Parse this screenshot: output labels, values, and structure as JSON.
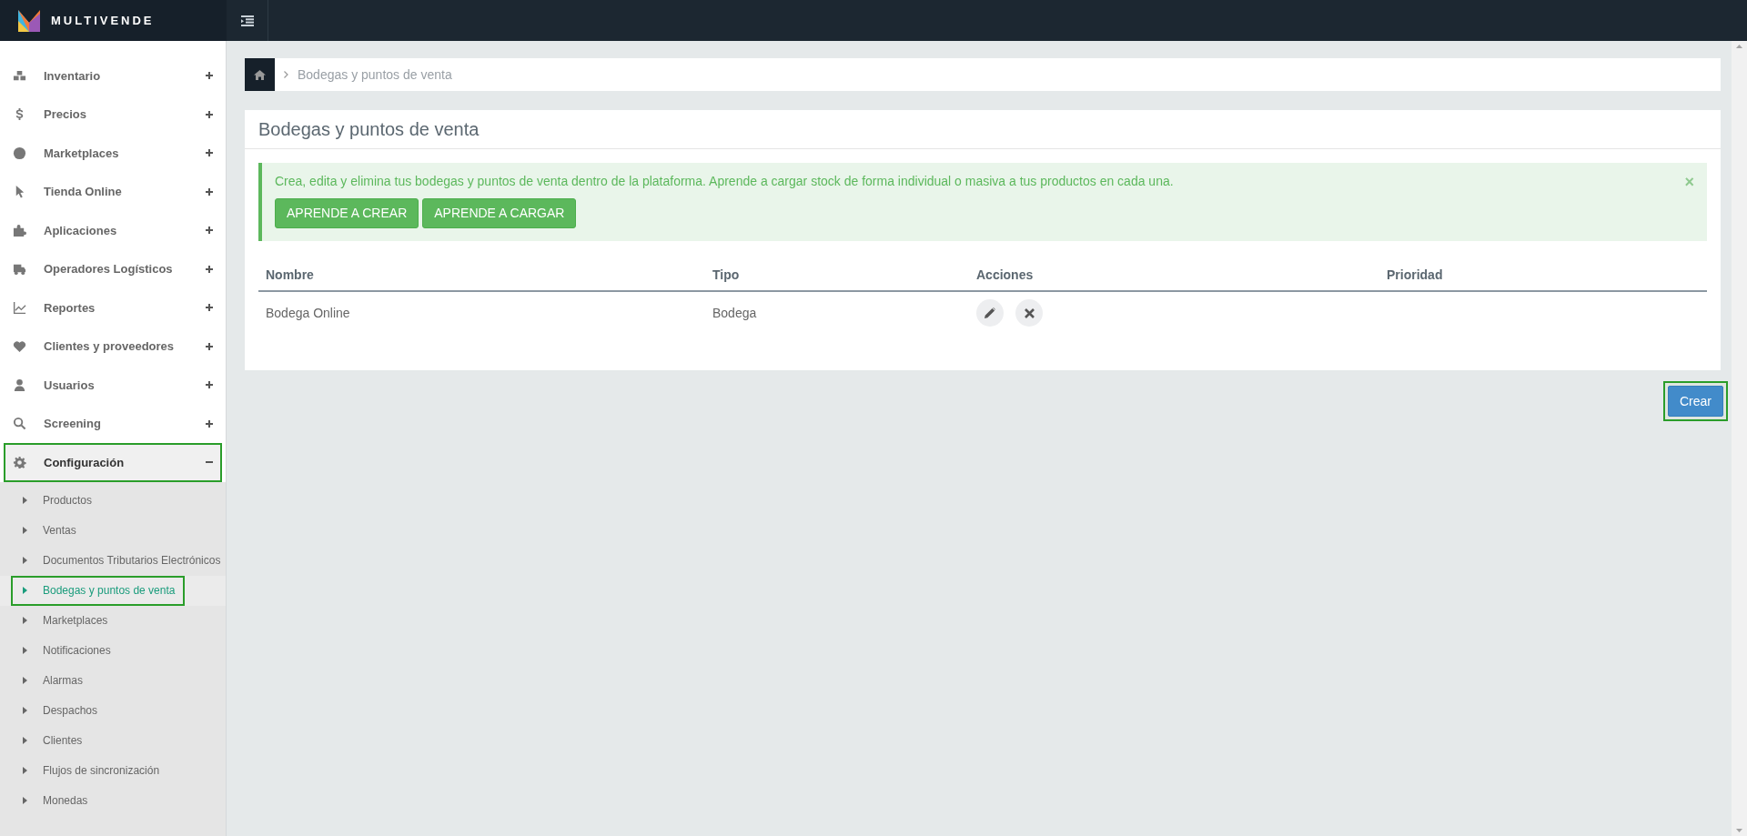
{
  "brand": {
    "name": "MULTIVENDE"
  },
  "sidebar": {
    "items": [
      {
        "label": "Inventario",
        "expanded": false,
        "highlighted": false
      },
      {
        "label": "Precios",
        "expanded": false,
        "highlighted": false
      },
      {
        "label": "Marketplaces",
        "expanded": false,
        "highlighted": false
      },
      {
        "label": "Tienda Online",
        "expanded": false,
        "highlighted": false
      },
      {
        "label": "Aplicaciones",
        "expanded": false,
        "highlighted": false
      },
      {
        "label": "Operadores Logísticos",
        "expanded": false,
        "highlighted": false
      },
      {
        "label": "Reportes",
        "expanded": false,
        "highlighted": false
      },
      {
        "label": "Clientes y proveedores",
        "expanded": false,
        "highlighted": false
      },
      {
        "label": "Usuarios",
        "expanded": false,
        "highlighted": false
      },
      {
        "label": "Screening",
        "expanded": false,
        "highlighted": false
      },
      {
        "label": "Configuración",
        "expanded": true,
        "highlighted": true,
        "children": [
          {
            "label": "Productos",
            "selected": false
          },
          {
            "label": "Ventas",
            "selected": false
          },
          {
            "label": "Documentos Tributarios Electrónicos",
            "selected": false
          },
          {
            "label": "Bodegas y puntos de venta",
            "selected": true
          },
          {
            "label": "Marketplaces",
            "selected": false
          },
          {
            "label": "Notificaciones",
            "selected": false
          },
          {
            "label": "Alarmas",
            "selected": false
          },
          {
            "label": "Despachos",
            "selected": false
          },
          {
            "label": "Clientes",
            "selected": false
          },
          {
            "label": "Flujos de sincronización",
            "selected": false
          },
          {
            "label": "Monedas",
            "selected": false
          }
        ]
      }
    ]
  },
  "breadcrumb": [
    "Bodegas y puntos de venta"
  ],
  "card": {
    "title": "Bodegas y puntos de venta",
    "alert": {
      "text": "Crea, edita y elimina tus bodegas y puntos de venta dentro de la plataforma. Aprende a cargar stock de forma individual o masiva a tus productos en cada una.",
      "close": "×",
      "buttons": [
        "APRENDE A CREAR",
        "APRENDE A CARGAR"
      ]
    },
    "table": {
      "columns": [
        "Nombre",
        "Tipo",
        "Acciones",
        "Prioridad"
      ],
      "rows": [
        {
          "nombre": "Bodega Online",
          "tipo": "Bodega"
        }
      ]
    }
  },
  "create_button": {
    "label": "Crear",
    "highlighted": true
  }
}
